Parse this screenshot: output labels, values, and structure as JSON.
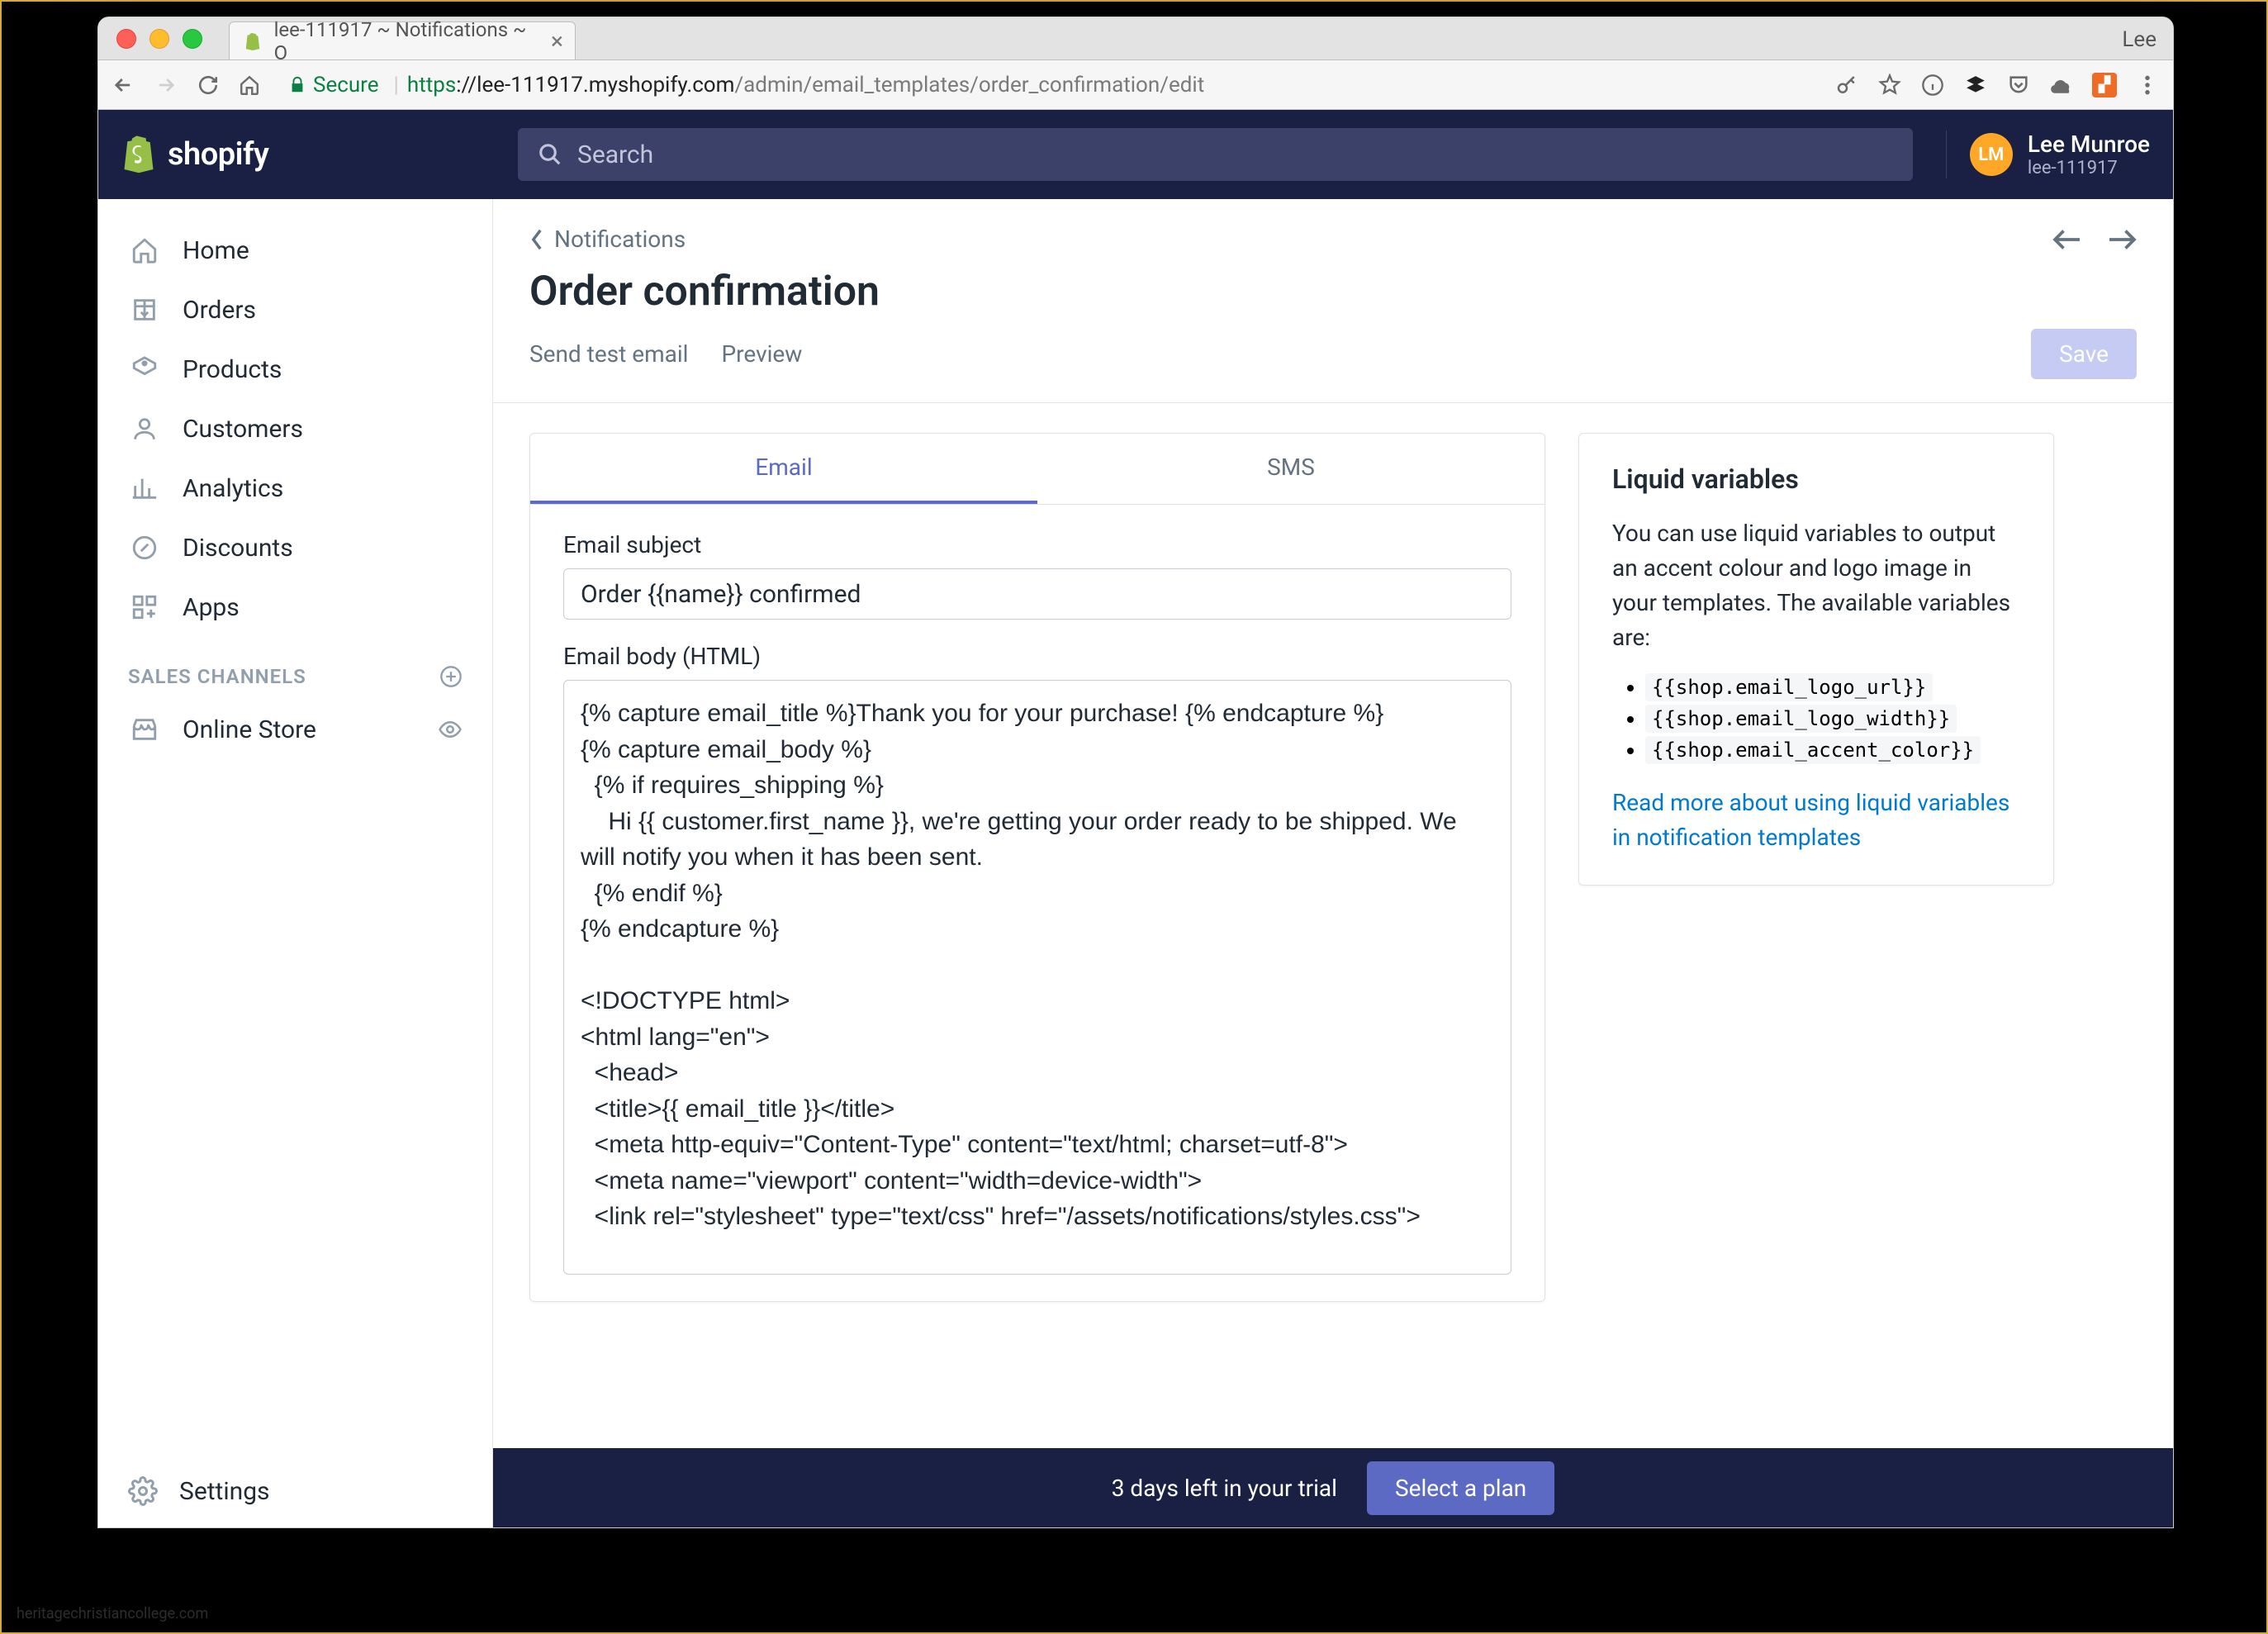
{
  "browser": {
    "tab_title": "lee-111917 ~ Notifications ~ O",
    "profile": "Lee",
    "secure_label": "Secure",
    "url_proto": "https",
    "url_host": "://lee-111917.myshopify.com",
    "url_path": "/admin/email_templates/order_confirmation/edit"
  },
  "header": {
    "brand": "shopify",
    "search_placeholder": "Search",
    "avatar_initials": "LM",
    "user_name": "Lee Munroe",
    "user_store": "lee-111917"
  },
  "sidebar": {
    "home": "Home",
    "orders": "Orders",
    "products": "Products",
    "customers": "Customers",
    "analytics": "Analytics",
    "discounts": "Discounts",
    "apps": "Apps",
    "channels_header": "SALES CHANNELS",
    "online_store": "Online Store",
    "settings": "Settings"
  },
  "page": {
    "breadcrumb": "Notifications",
    "title": "Order confirmation",
    "send_test": "Send test email",
    "preview": "Preview",
    "save": "Save",
    "tab_email": "Email",
    "tab_sms": "SMS",
    "subject_label": "Email subject",
    "subject_value": "Order {{name}} confirmed",
    "body_label": "Email body (HTML)",
    "body_value": "{% capture email_title %}Thank you for your purchase! {% endcapture %}\n{% capture email_body %}\n  {% if requires_shipping %}\n    Hi {{ customer.first_name }}, we're getting your order ready to be shipped. We will notify you when it has been sent.\n  {% endif %}\n{% endcapture %}\n\n<!DOCTYPE html>\n<html lang=\"en\">\n  <head>\n  <title>{{ email_title }}</title>\n  <meta http-equiv=\"Content-Type\" content=\"text/html; charset=utf-8\">\n  <meta name=\"viewport\" content=\"width=device-width\">\n  <link rel=\"stylesheet\" type=\"text/css\" href=\"/assets/notifications/styles.css\">"
  },
  "liquid": {
    "heading": "Liquid variables",
    "desc": "You can use liquid variables to output an accent colour and logo image in your templates. The available variables are:",
    "var1": "{{shop.email_logo_url}}",
    "var2": "{{shop.email_logo_width}}",
    "var3": "{{shop.email_accent_color}}",
    "link": "Read more about using liquid variables in notification templates"
  },
  "trial": {
    "message": "3 days left in your trial",
    "button": "Select a plan"
  },
  "footer_small": "heritagechristiancollege.com"
}
